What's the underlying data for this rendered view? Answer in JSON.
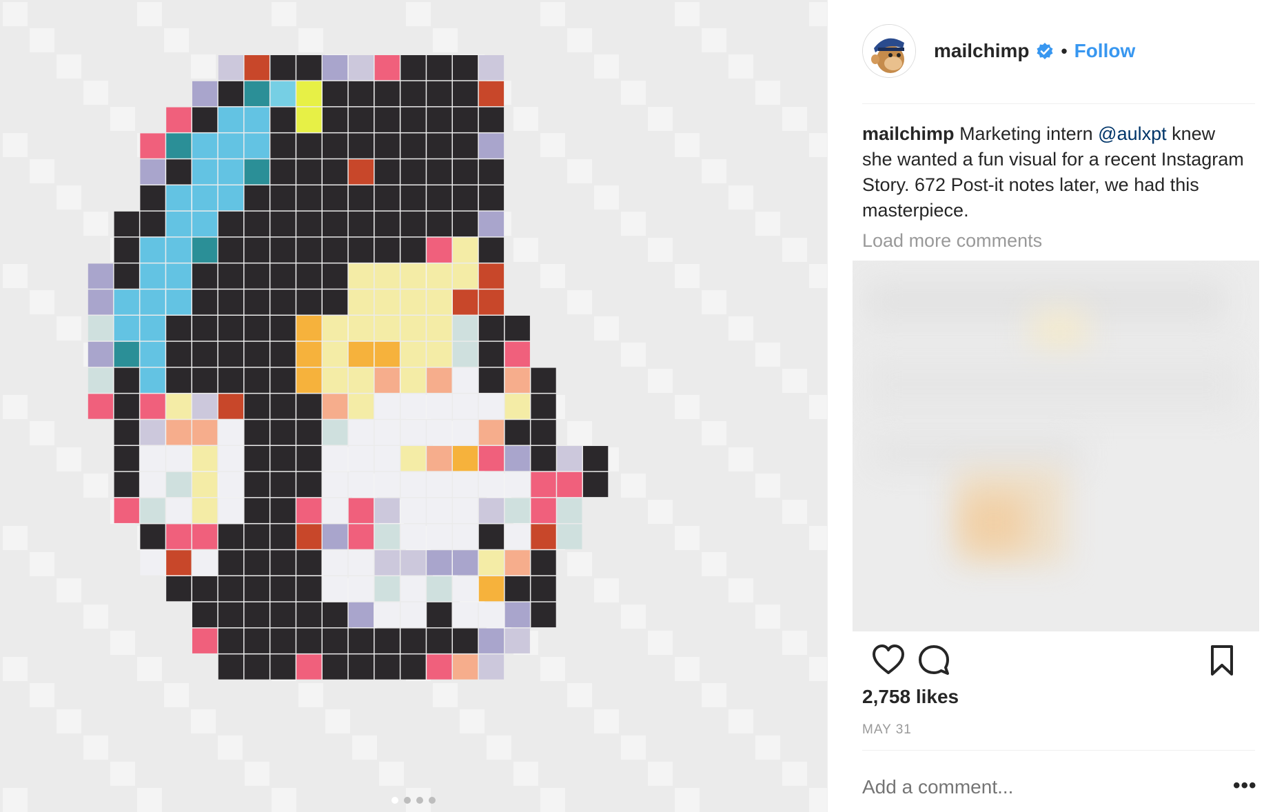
{
  "post": {
    "username": "mailchimp",
    "separator": "•",
    "follow_label": "Follow",
    "caption": {
      "username": "mailchimp",
      "text_before": "Marketing intern ",
      "mention": "@aulxpt",
      "text_after": "knew she wanted a fun visual for a recent Instagram Story. 672 Post-it notes later, we had this masterpiece."
    },
    "load_more_label": "Load more comments",
    "likes": "2,758 likes",
    "date": "MAY 31",
    "comment_placeholder": "Add a comment...",
    "more_options": "•••",
    "carousel": {
      "count": 4,
      "active": 0
    }
  },
  "icons": {
    "avatar": "mailchimp-freddie-avatar-icon",
    "verified": "verified-badge-icon",
    "like": "heart-icon",
    "comment": "comment-bubble-icon",
    "save": "bookmark-icon"
  },
  "colors": {
    "accent": "#3897f0",
    "mention": "#003569",
    "muted": "#999999",
    "text": "#262626",
    "divider": "#efefef"
  }
}
